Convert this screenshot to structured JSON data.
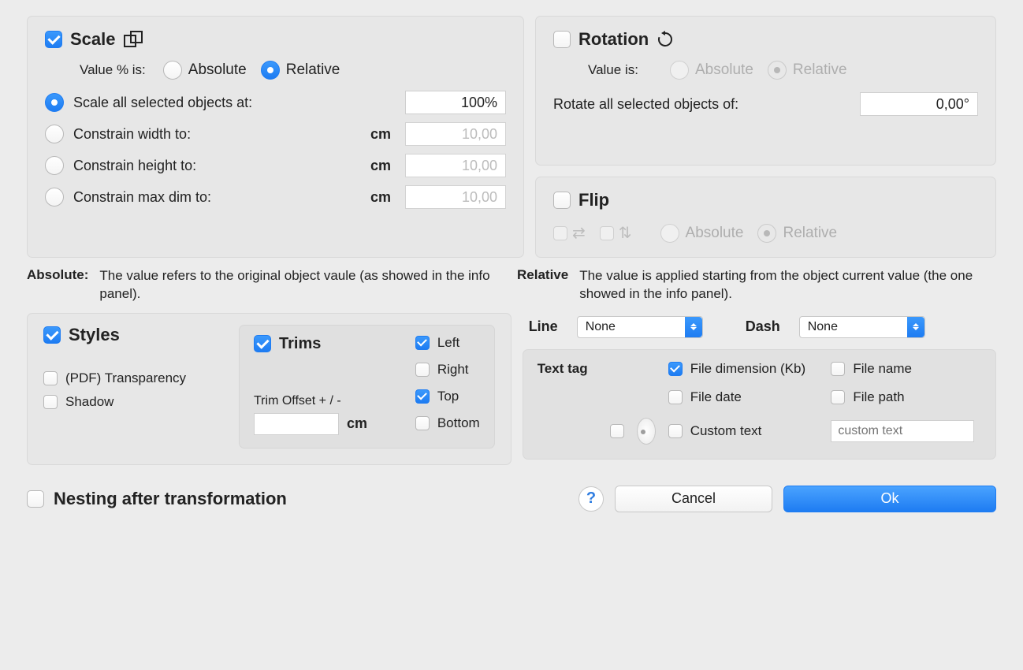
{
  "scale": {
    "title": "Scale",
    "enabled": true,
    "valueLabel": "Value % is:",
    "absolute": "Absolute",
    "relative": "Relative",
    "mode": "relative",
    "option": "scale_all",
    "scaleAll": "Scale all selected objects at:",
    "scaleValue": "100%",
    "constrainWidth": "Constrain width to:",
    "constrainHeight": "Constrain height to:",
    "constrainMax": "Constrain max dim to:",
    "unit": "cm",
    "dimValue": "10,00"
  },
  "rotation": {
    "title": "Rotation",
    "enabled": false,
    "valueLabel": "Value is:",
    "absolute": "Absolute",
    "relative": "Relative",
    "rotateAll": "Rotate all selected objects of:",
    "rotateValue": "0,00°"
  },
  "flip": {
    "title": "Flip",
    "enabled": false,
    "absolute": "Absolute",
    "relative": "Relative"
  },
  "help": {
    "absKey": "Absolute:",
    "absVal": "The value refers to the original object vaule (as showed in the info panel).",
    "relKey": "Relative",
    "relVal": "The value is applied starting from the object current value (the one showed in the info panel)."
  },
  "styles": {
    "title": "Styles",
    "enabled": true,
    "pdfTransparency": "(PDF) Transparency",
    "shadow": "Shadow"
  },
  "trims": {
    "title": "Trims",
    "enabled": true,
    "left": "Left",
    "right": "Right",
    "top": "Top",
    "bottom": "Bottom",
    "leftOn": true,
    "rightOn": false,
    "topOn": true,
    "bottomOn": false,
    "offsetLabel": "Trim Offset + / -",
    "unit": "cm"
  },
  "lineDash": {
    "lineLabel": "Line",
    "lineValue": "None",
    "dashLabel": "Dash",
    "dashValue": "None"
  },
  "tag": {
    "title": "Text tag",
    "fileDim": "File dimension (Kb)",
    "fileDimOn": true,
    "fileName": "File name",
    "fileDate": "File date",
    "filePath": "File path",
    "customText": "Custom text",
    "customPlaceholder": "custom text"
  },
  "bottom": {
    "nesting": "Nesting after transformation",
    "cancel": "Cancel",
    "ok": "Ok"
  }
}
